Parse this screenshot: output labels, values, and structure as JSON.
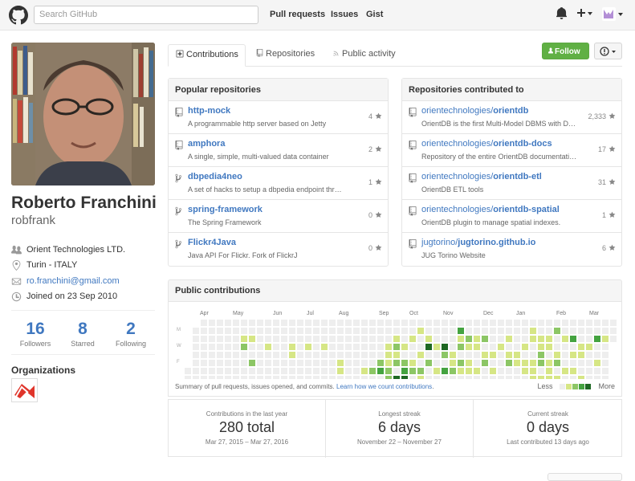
{
  "header": {
    "search_placeholder": "Search GitHub",
    "nav": [
      "Pull requests",
      "Issues",
      "Gist"
    ],
    "icons": [
      "github-logo-icon",
      "bell-icon",
      "plus-icon",
      "avatar-icon"
    ]
  },
  "profile": {
    "fullname": "Roberto Franchini",
    "username": "robfrank",
    "company": "Orient Technologies LTD.",
    "location": "Turin - ITALY",
    "email": "ro.franchini@gmail.com",
    "joined": "Joined on 23 Sep 2010",
    "stats": [
      {
        "num": "16",
        "label": "Followers"
      },
      {
        "num": "8",
        "label": "Starred"
      },
      {
        "num": "2",
        "label": "Following"
      }
    ],
    "orgs_heading": "Organizations"
  },
  "tabs": [
    "Contributions",
    "Repositories",
    "Public activity"
  ],
  "follow_label": "Follow",
  "popular": {
    "title": "Popular repositories",
    "repos": [
      {
        "name": "http-mock",
        "owner": "",
        "desc": "A programmable http server based on Jetty",
        "stars": "4",
        "icon": "repo-icon"
      },
      {
        "name": "amphora",
        "owner": "",
        "desc": "A single, simple, multi-valued data container",
        "stars": "2",
        "icon": "repo-icon"
      },
      {
        "name": "dbpedia4neo",
        "owner": "",
        "desc": "A set of hacks to setup a dbpedia endpoint thr…",
        "stars": "1",
        "icon": "fork-icon"
      },
      {
        "name": "spring-framework",
        "owner": "",
        "desc": "The Spring Framework",
        "stars": "0",
        "icon": "fork-icon"
      },
      {
        "name": "Flickr4Java",
        "owner": "",
        "desc": "Java API For Flickr. Fork of FlickrJ",
        "stars": "0",
        "icon": "fork-icon"
      }
    ]
  },
  "contributed": {
    "title": "Repositories contributed to",
    "repos": [
      {
        "owner": "orientechnologies/",
        "name": "orientdb",
        "desc": "OrientDB is the first Multi-Model DBMS with D…",
        "stars": "2,333"
      },
      {
        "owner": "orientechnologies/",
        "name": "orientdb-docs",
        "desc": "Repository of the entire OrientDB documentati…",
        "stars": "17"
      },
      {
        "owner": "orientechnologies/",
        "name": "orientdb-etl",
        "desc": "OrientDB ETL tools",
        "stars": "31"
      },
      {
        "owner": "orientechnologies/",
        "name": "orientdb-spatial",
        "desc": "OrientDB plugin to manage spatial indexes.",
        "stars": "1"
      },
      {
        "owner": "jugtorino/",
        "name": "jugtorino.github.io",
        "desc": "JUG Torino Website",
        "stars": "6"
      }
    ]
  },
  "contributions": {
    "title": "Public contributions",
    "months": [
      "Apr",
      "May",
      "Jun",
      "Jul",
      "Aug",
      "Sep",
      "Oct",
      "Nov",
      "Dec",
      "Jan",
      "Feb",
      "Mar"
    ],
    "weekdays": [
      "M",
      "W",
      "F"
    ],
    "summary": "Summary of pull requests, issues opened, and commits.",
    "learn_link": "Learn how we count contributions",
    "summary_end": ".",
    "legend_less": "Less",
    "legend_more": "More",
    "colors": [
      "#eeeeee",
      "#d6e685",
      "#8cc665",
      "#44a340",
      "#1e6823"
    ]
  },
  "streaks": [
    {
      "title": "Contributions in the last year",
      "value": "280 total",
      "detail": "Mar 27, 2015 – Mar 27, 2016"
    },
    {
      "title": "Longest streak",
      "value": "6 days",
      "detail": "November 22 – November 27"
    },
    {
      "title": "Current streak",
      "value": "0 days",
      "detail": "Last contributed 13 days ago"
    }
  ]
}
